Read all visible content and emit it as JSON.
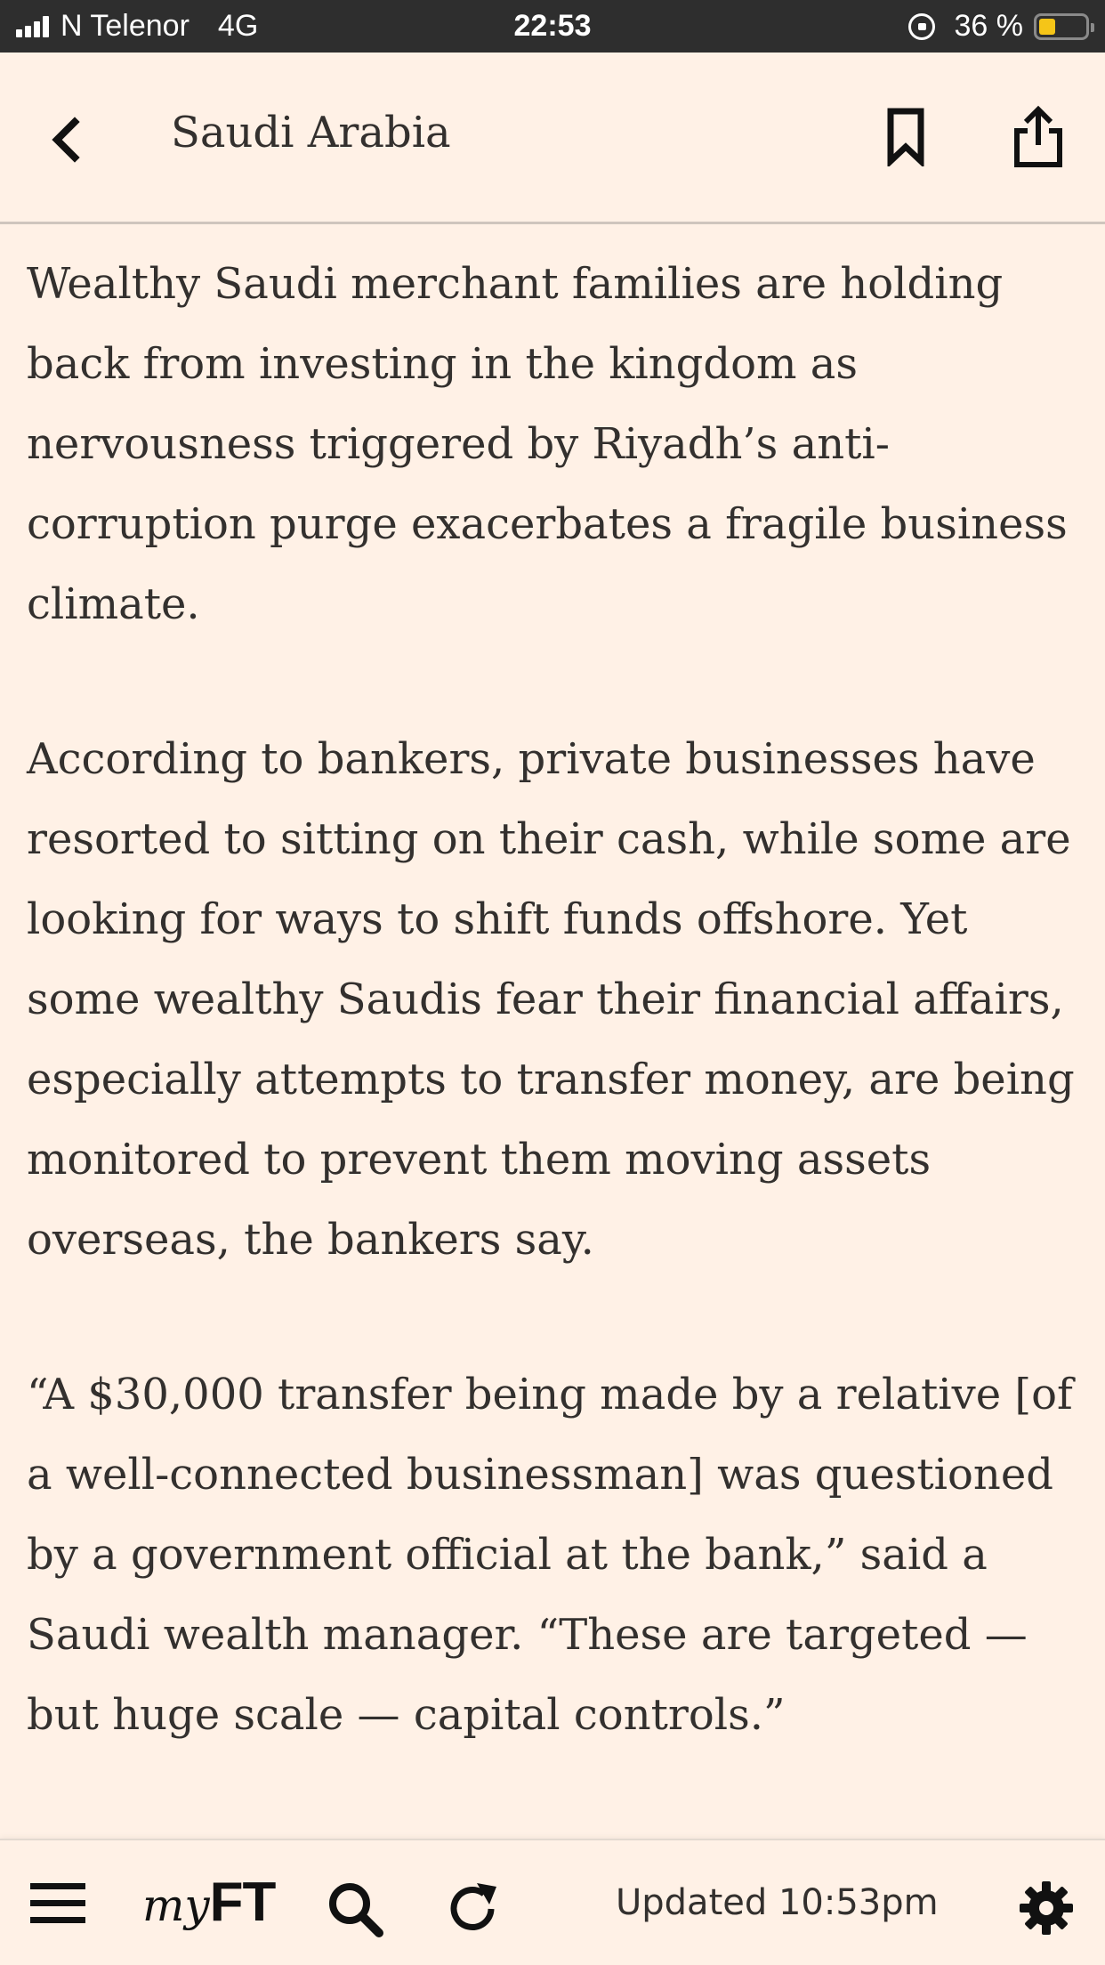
{
  "status_bar": {
    "carrier": "N Telenor",
    "network": "4G",
    "time": "22:53",
    "battery_percent": "36 %",
    "battery_level": 0.36,
    "battery_color": "#f5c518"
  },
  "header": {
    "title": "Saudi Arabia",
    "back_icon": "chevron-left-icon",
    "bookmark_icon": "bookmark-icon",
    "share_icon": "share-icon"
  },
  "article": {
    "paragraphs": [
      "Wealthy Saudi merchant families are holding back from investing in the kingdom as nervousness triggered by Riyadh’s anti-corruption purge exacerbates a fragile business climate.",
      "According to bankers, private businesses have resorted to sitting on their cash, while some are looking for ways to shift funds offshore. Yet some wealthy Saudis fear their financial affairs, especially attempts to transfer money, are being monitored to prevent them moving assets overseas, the bankers say.",
      "“A $30,000 transfer being made by a relative [of a well-connected businessman] was questioned by a government official at the bank,” said a Saudi wealth manager. “These are targeted — but huge scale — capital controls.”"
    ]
  },
  "toolbar": {
    "myft_my": "my",
    "myft_ft": "FT",
    "updated": "Updated 10:53pm",
    "icons": [
      "menu-icon",
      "search-icon",
      "refresh-icon",
      "gear-icon"
    ]
  },
  "colors": {
    "background": "#fff1e6",
    "text": "#33302e",
    "status_bar": "#2e2e2e"
  }
}
